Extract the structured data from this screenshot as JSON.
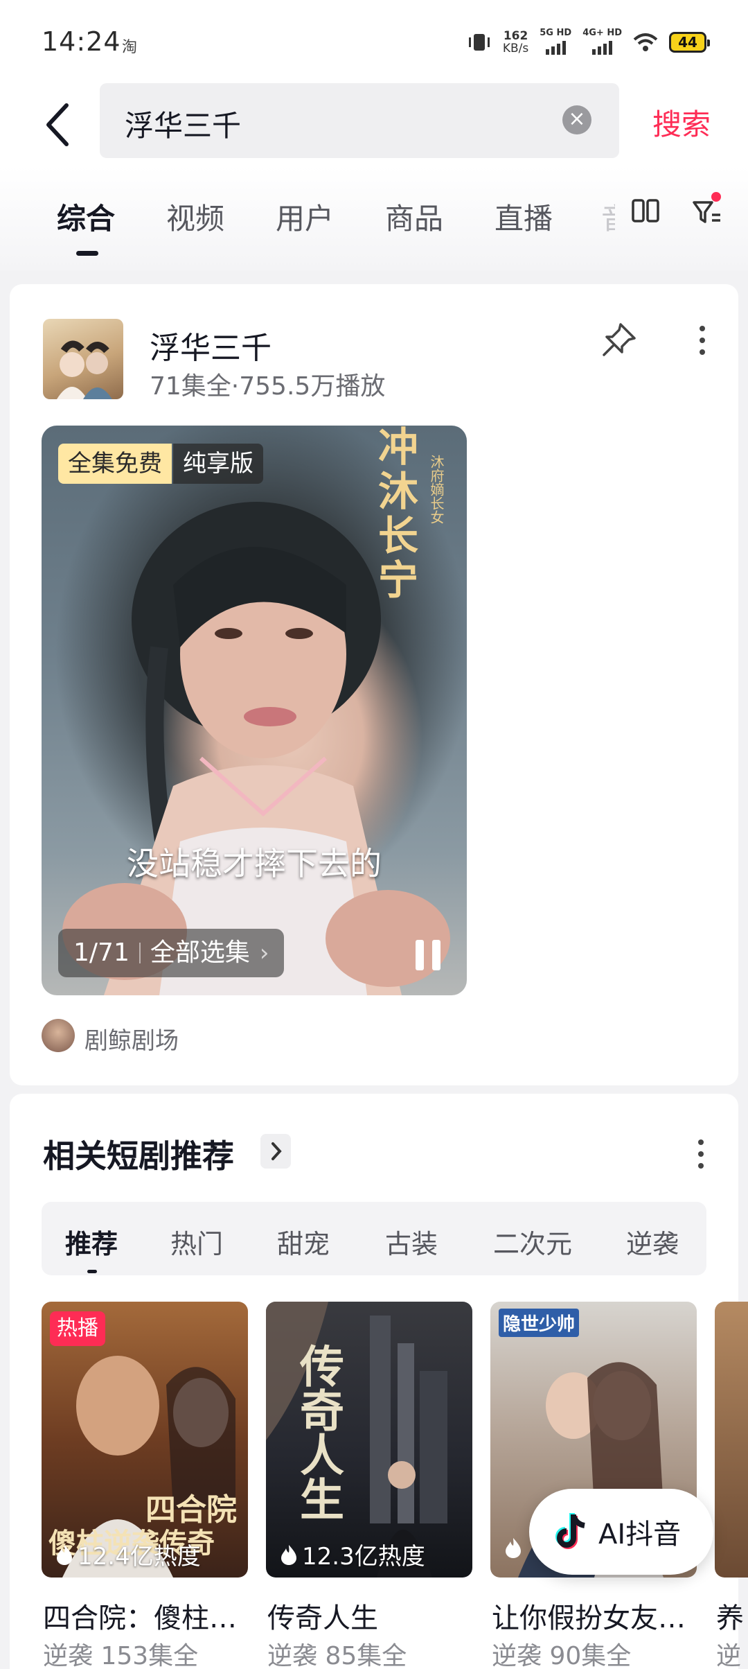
{
  "status_bar": {
    "time": "14:24",
    "app_glyph": "淘",
    "net_speed_value": "162",
    "net_speed_unit": "KB/s",
    "sim1": "5G HD",
    "sim2": "4G+ HD",
    "battery": "44"
  },
  "search": {
    "query": "浮华三千",
    "submit_label": "搜索"
  },
  "tabs": [
    {
      "label": "综合",
      "active": true
    },
    {
      "label": "视频"
    },
    {
      "label": "用户"
    },
    {
      "label": "商品"
    },
    {
      "label": "直播"
    }
  ],
  "result": {
    "title": "浮华三千",
    "meta": "71集全·755.5万播放",
    "badge_free": "全集免费",
    "badge_pure": "纯享版",
    "poster_text": "冲沐长宁",
    "poster_sub": "沐府嫡长女",
    "subtitle": "没站稳才摔下去的",
    "episode": "1/71",
    "episode_select": "全部选集",
    "author": "剧鲸剧场"
  },
  "related": {
    "title": "相关短剧推荐",
    "tabs": [
      "推荐",
      "热门",
      "甜宠",
      "古装",
      "二次元",
      "逆袭"
    ],
    "items": [
      {
        "badge": "热播",
        "art": "四合院",
        "art2": "傻柱逆袭传奇",
        "heat": "12.4亿热度",
        "title": "四合院：傻柱…",
        "sub": "逆袭 153集全"
      },
      {
        "art": "传奇人生",
        "heat": "12.3亿热度",
        "title": "传奇人生",
        "sub": "逆袭 85集全"
      },
      {
        "art": "隐世少帅",
        "heat": "",
        "title": "让你假扮女友…",
        "sub": "逆袭 90集全"
      },
      {
        "title": "养",
        "sub": "逆"
      }
    ]
  },
  "fab": {
    "label": "AI抖音"
  },
  "colors": {
    "accent": "#fe2c55",
    "text": "#161823",
    "muted": "#6b6c72"
  }
}
